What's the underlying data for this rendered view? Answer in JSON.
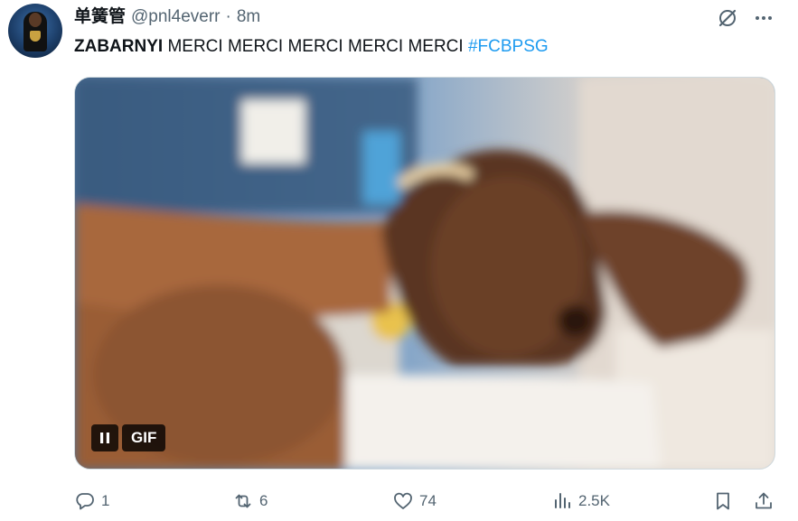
{
  "post": {
    "author": {
      "display_name": "单簧管",
      "handle": "@pnl4everr",
      "separator": "·",
      "time": "8m"
    },
    "text": {
      "bold_part": "ZABARNYI",
      "body": " MERCI MERCI MERCI MERCI MERCI ",
      "hashtag": "#FCBPSG"
    },
    "media": {
      "type": "gif",
      "badge_label": "GIF",
      "playback": "playing"
    },
    "header_icons": [
      "grok-icon",
      "more-icon"
    ],
    "actions": {
      "reply": {
        "icon": "reply-icon",
        "count": "1"
      },
      "repost": {
        "icon": "repost-icon",
        "count": "6"
      },
      "like": {
        "icon": "like-icon",
        "count": "74"
      },
      "views": {
        "icon": "views-icon",
        "count": "2.5K"
      },
      "bookmark": {
        "icon": "bookmark-icon"
      },
      "share": {
        "icon": "share-icon"
      }
    }
  },
  "colors": {
    "text": "#0f1419",
    "secondary": "#536471",
    "link": "#1d9bf0",
    "border": "#cfd9de"
  }
}
